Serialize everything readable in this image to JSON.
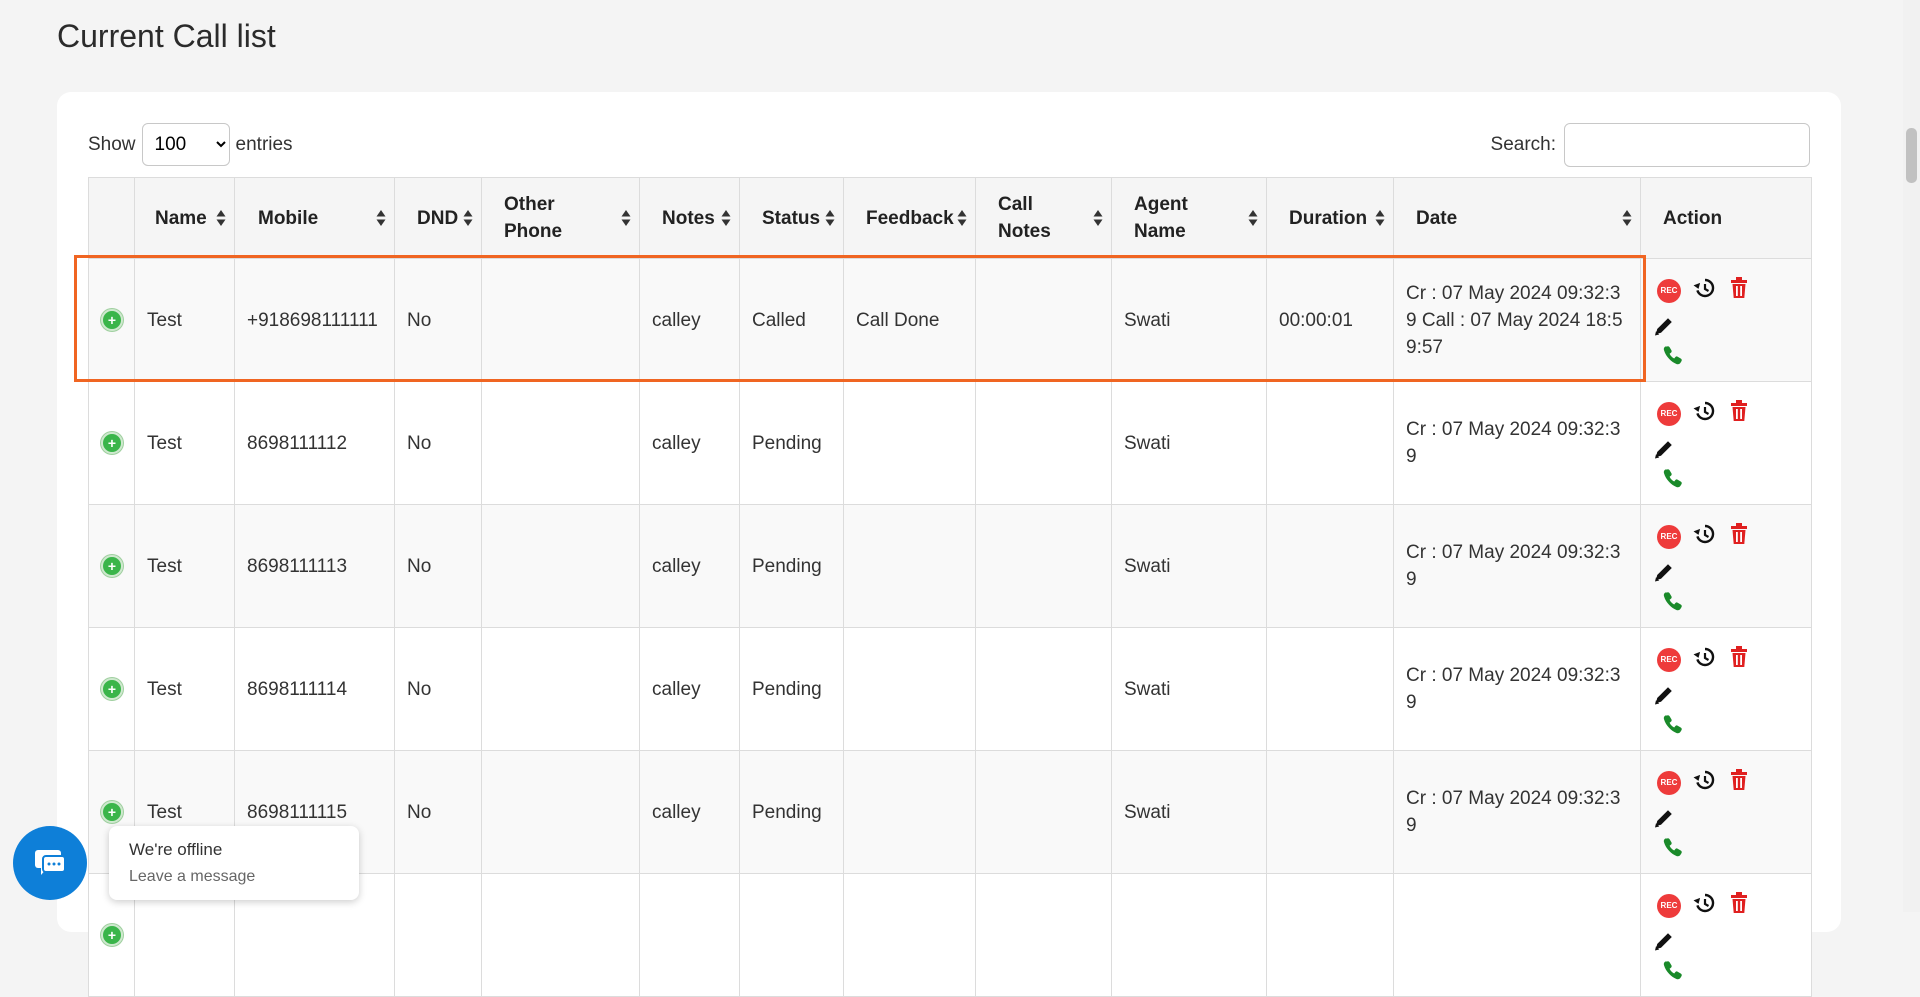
{
  "page": {
    "title": "Current Call list"
  },
  "controls": {
    "show_label": "Show",
    "entries_label": "entries",
    "page_size": "100",
    "search_label": "Search:",
    "search_value": ""
  },
  "table": {
    "headers": [
      {
        "key": "expand",
        "label": "",
        "sortable": false
      },
      {
        "key": "name",
        "label": "Name",
        "sortable": true
      },
      {
        "key": "mobile",
        "label": "Mobile",
        "sortable": true
      },
      {
        "key": "dnd",
        "label": "DND",
        "sortable": true
      },
      {
        "key": "other_phone",
        "label": "Other Phone",
        "sortable": true
      },
      {
        "key": "notes",
        "label": "Notes",
        "sortable": true
      },
      {
        "key": "status",
        "label": "Status",
        "sortable": true
      },
      {
        "key": "feedback",
        "label": "Feedback",
        "sortable": true
      },
      {
        "key": "call_notes",
        "label": "Call Notes",
        "sortable": true
      },
      {
        "key": "agent_name",
        "label": "Agent Name",
        "sortable": true
      },
      {
        "key": "duration",
        "label": "Duration",
        "sortable": true
      },
      {
        "key": "date",
        "label": "Date",
        "sortable": true
      },
      {
        "key": "action",
        "label": "Action",
        "sortable": false
      }
    ],
    "rows": [
      {
        "name": "Test",
        "mobile": "+918698111111",
        "dnd": "No",
        "other_phone": "",
        "notes": "calley",
        "status": "Called",
        "feedback": "Call Done",
        "call_notes": "",
        "agent_name": "Swati",
        "duration": "00:00:01",
        "date": "Cr : 07 May 2024 09:32:39 Call : 07 May 2024 18:59:57"
      },
      {
        "name": "Test",
        "mobile": "8698111112",
        "dnd": "No",
        "other_phone": "",
        "notes": "calley",
        "status": "Pending",
        "feedback": "",
        "call_notes": "",
        "agent_name": "Swati",
        "duration": "",
        "date": "Cr : 07 May 2024 09:32:39"
      },
      {
        "name": "Test",
        "mobile": "8698111113",
        "dnd": "No",
        "other_phone": "",
        "notes": "calley",
        "status": "Pending",
        "feedback": "",
        "call_notes": "",
        "agent_name": "Swati",
        "duration": "",
        "date": "Cr : 07 May 2024 09:32:39"
      },
      {
        "name": "Test",
        "mobile": "8698111114",
        "dnd": "No",
        "other_phone": "",
        "notes": "calley",
        "status": "Pending",
        "feedback": "",
        "call_notes": "",
        "agent_name": "Swati",
        "duration": "",
        "date": "Cr : 07 May 2024 09:32:39"
      },
      {
        "name": "Test",
        "mobile": "8698111115",
        "dnd": "No",
        "other_phone": "",
        "notes": "calley",
        "status": "Pending",
        "feedback": "",
        "call_notes": "",
        "agent_name": "Swati",
        "duration": "",
        "date": "Cr : 07 May 2024 09:32:39"
      },
      {
        "name": "",
        "mobile": "",
        "dnd": "",
        "other_phone": "",
        "notes": "",
        "status": "",
        "feedback": "",
        "call_notes": "",
        "agent_name": "",
        "duration": "",
        "date": ""
      }
    ]
  },
  "actions": {
    "rec_label": "REC"
  },
  "chat": {
    "title": "We're offline",
    "subtitle": "Leave a message"
  },
  "colors": {
    "accent": "#f06522",
    "chat": "#0e7fd8",
    "add": "#3ab54a",
    "delete": "#e02020",
    "call": "#1a8a2a"
  },
  "icons": [
    "add-circle-icon",
    "rec-icon",
    "history-icon",
    "trash-icon",
    "pencil-icon",
    "phone-icon",
    "chat-icon",
    "sort-icon"
  ]
}
